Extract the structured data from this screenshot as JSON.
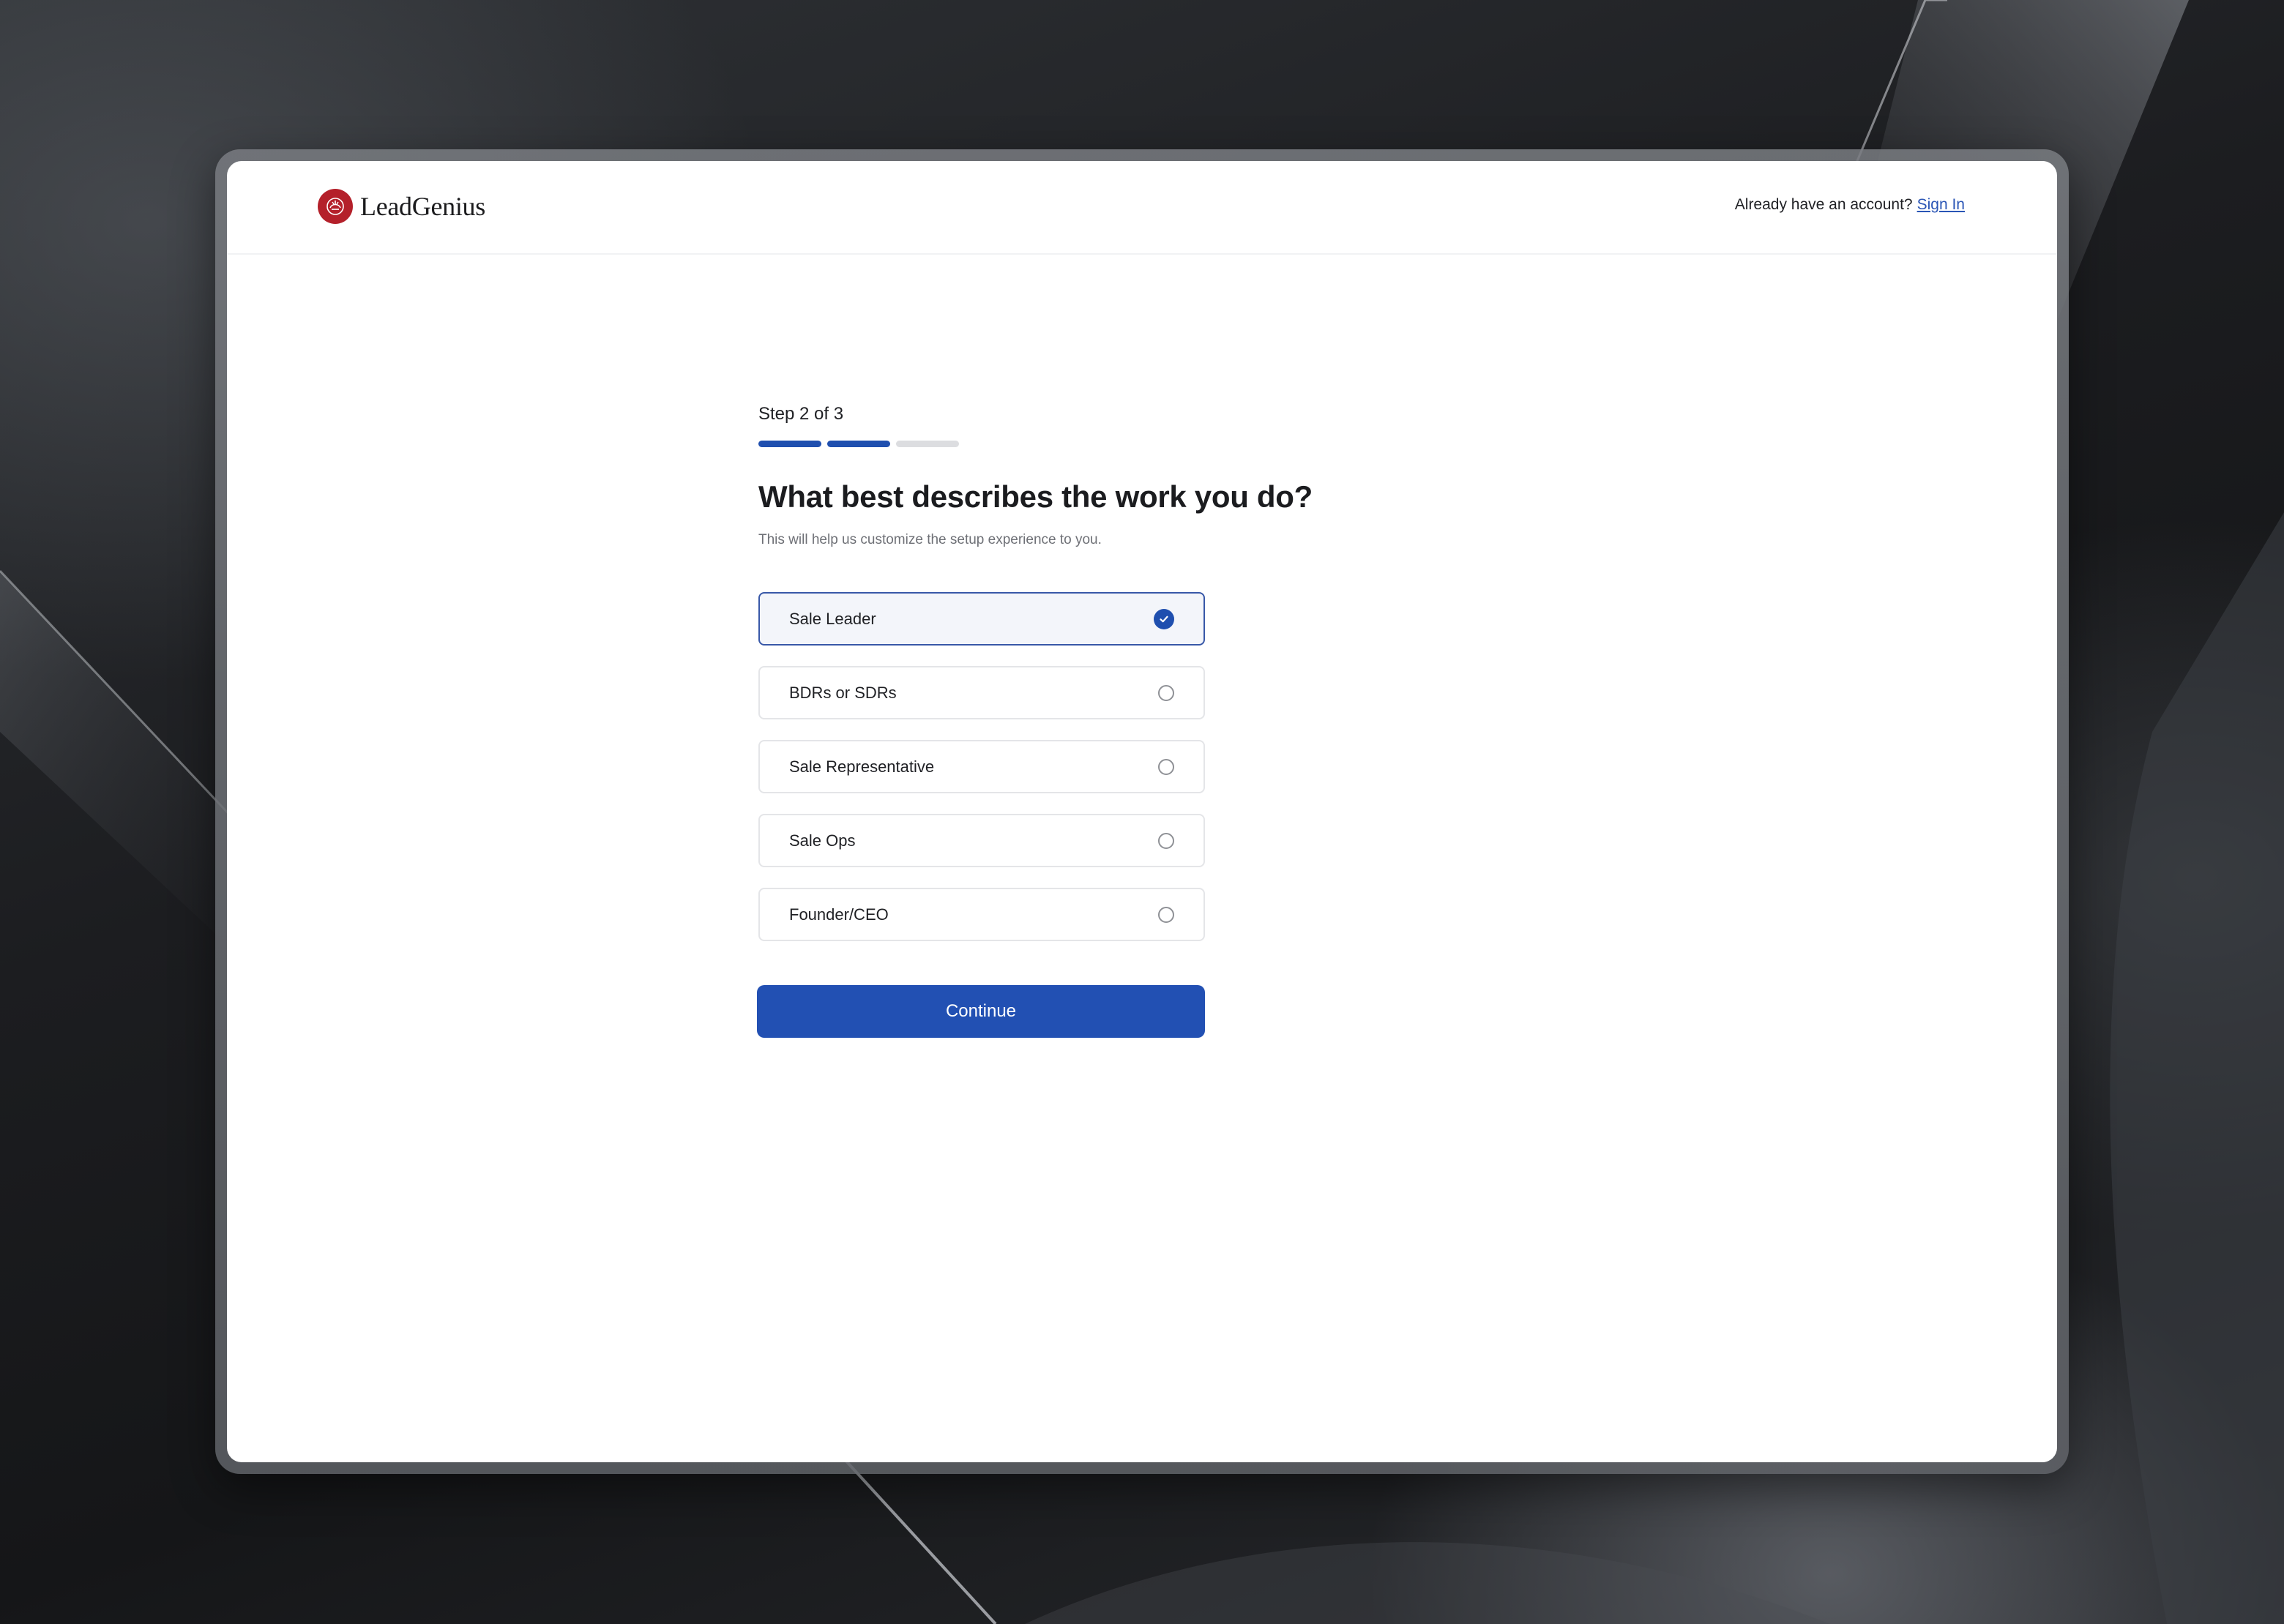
{
  "brand": {
    "name": "LeadGenius",
    "logo_icon": "leadgenius-logo-icon"
  },
  "header": {
    "account_prompt": "Already have an account?",
    "signin_label": "Sign In"
  },
  "onboarding": {
    "step_label": "Step 2 of 3",
    "current_step": 2,
    "total_steps": 3,
    "title": "What best describes the work you do?",
    "subtitle": "This will help us customize the setup experience to you.",
    "options": [
      {
        "label": "Sale Leader",
        "selected": true
      },
      {
        "label": "BDRs or SDRs",
        "selected": false
      },
      {
        "label": "Sale Representative",
        "selected": false
      },
      {
        "label": "Sale Ops",
        "selected": false
      },
      {
        "label": "Founder/CEO",
        "selected": false
      }
    ],
    "continue_label": "Continue"
  },
  "colors": {
    "accent": "#2250b3",
    "brand_red": "#b4202a"
  }
}
